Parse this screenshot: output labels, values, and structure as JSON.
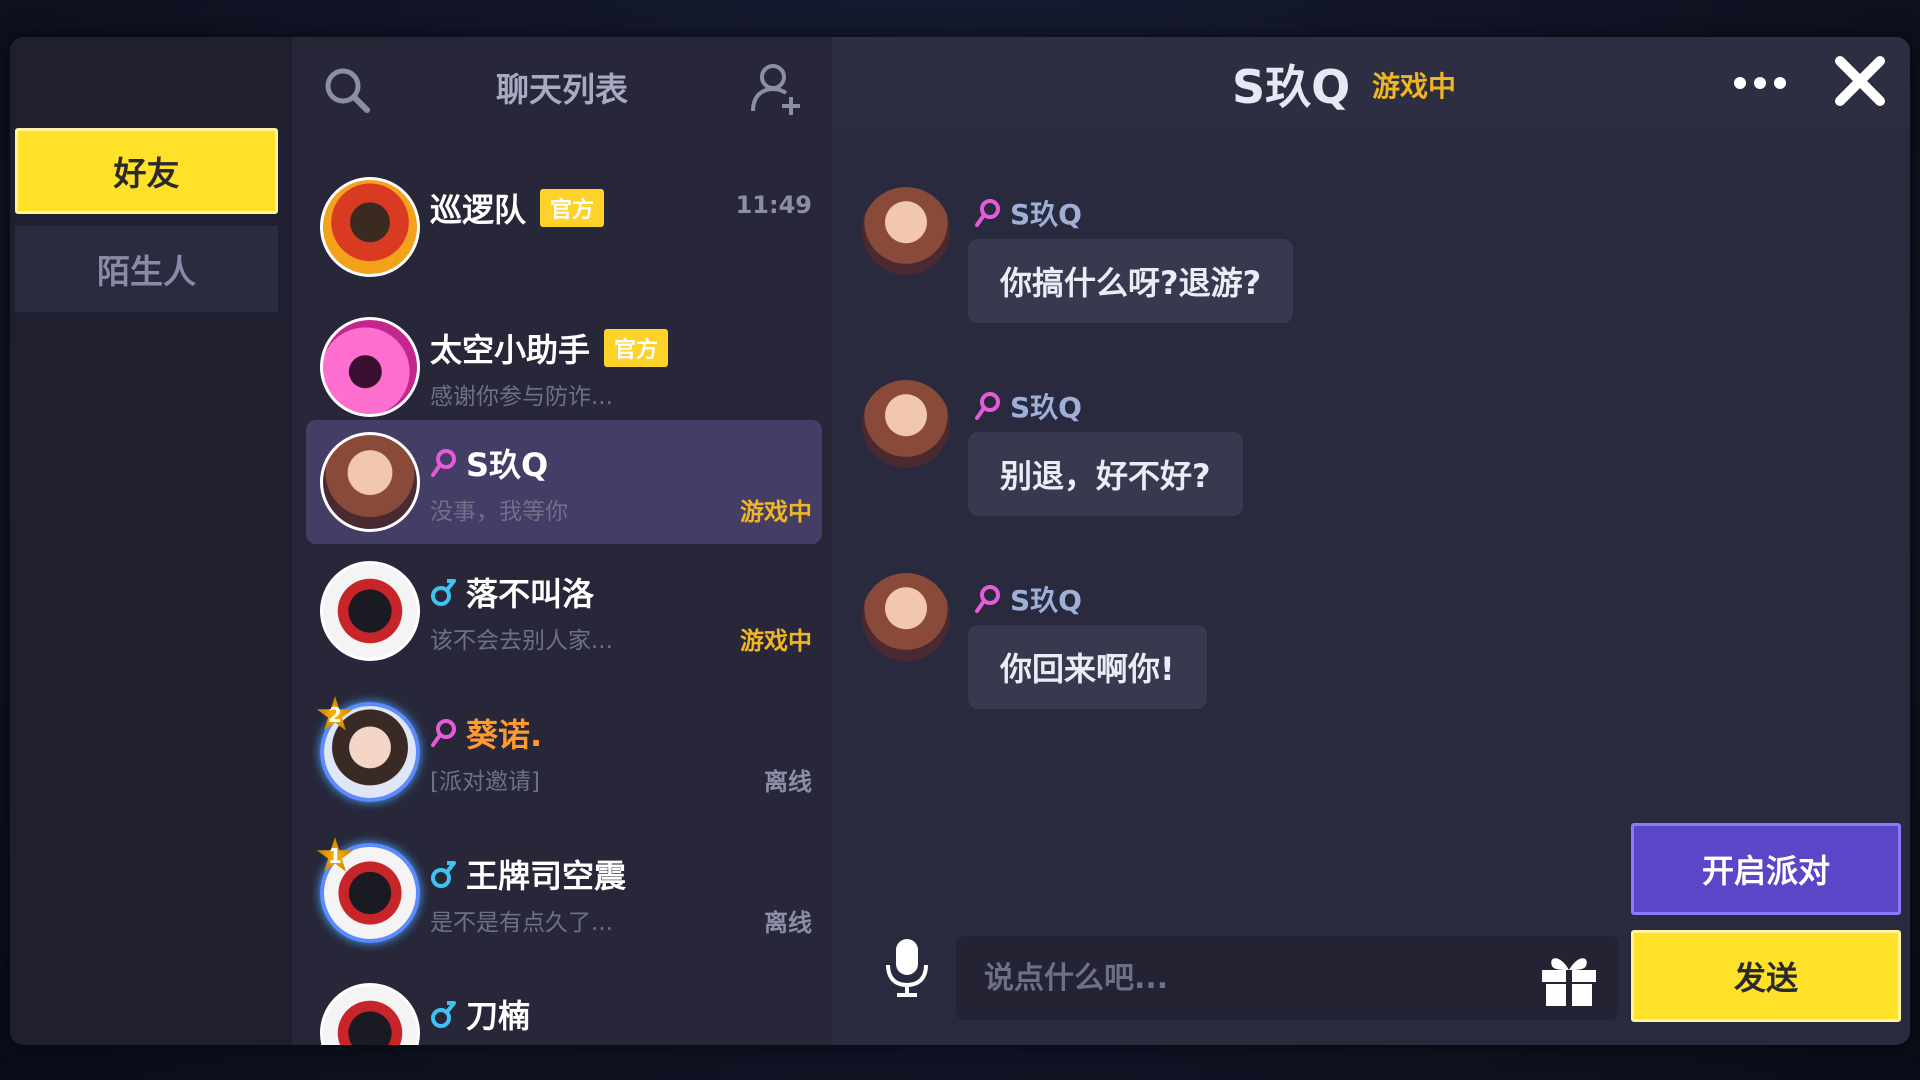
{
  "categories": {
    "friends": "好友",
    "strangers": "陌生人"
  },
  "chat_list": {
    "title": "聊天列表",
    "items": [
      {
        "name": "巡逻队",
        "badge": "官方",
        "time": "11:49",
        "preview": "",
        "status": ""
      },
      {
        "name": "太空小助手",
        "badge": "官方",
        "time": "",
        "preview": "感谢你参与防诈...",
        "status": ""
      },
      {
        "name": "S玖Q",
        "badge": "",
        "time": "",
        "preview": "没事，我等你",
        "status": "游戏中"
      },
      {
        "name": "落不叫洛",
        "badge": "",
        "time": "",
        "preview": "该不会去别人家...",
        "status": "游戏中"
      },
      {
        "name": "葵诺.",
        "badge": "",
        "time": "",
        "preview": "[派对邀请]",
        "status": "离线",
        "rank": "2"
      },
      {
        "name": "王牌司空震",
        "badge": "",
        "time": "",
        "preview": "是不是有点久了...",
        "status": "离线",
        "rank": "1"
      },
      {
        "name": "刀楠",
        "badge": "",
        "time": "",
        "preview": "",
        "status": ""
      }
    ]
  },
  "conversation": {
    "title": "S玖Q",
    "status": "游戏中",
    "messages": [
      {
        "sender": "S玖Q",
        "text": "你搞什么呀?退游?"
      },
      {
        "sender": "S玖Q",
        "text": "别退，好不好?"
      },
      {
        "sender": "S玖Q",
        "text": "你回来啊你!"
      }
    ]
  },
  "composer": {
    "placeholder": "说点什么吧...",
    "party_label": "开启派对",
    "send_label": "发送"
  },
  "colors": {
    "accent_yellow": "#ffe12a",
    "party_purple": "#5b46c8",
    "status_ingame": "#f0b522",
    "female_pink": "#e85bd8",
    "male_cyan": "#3fc3f0"
  },
  "icons": [
    "search-icon",
    "add-friend-icon",
    "more-icon",
    "close-icon",
    "mic-icon",
    "gift-icon",
    "female-icon",
    "male-icon"
  ]
}
